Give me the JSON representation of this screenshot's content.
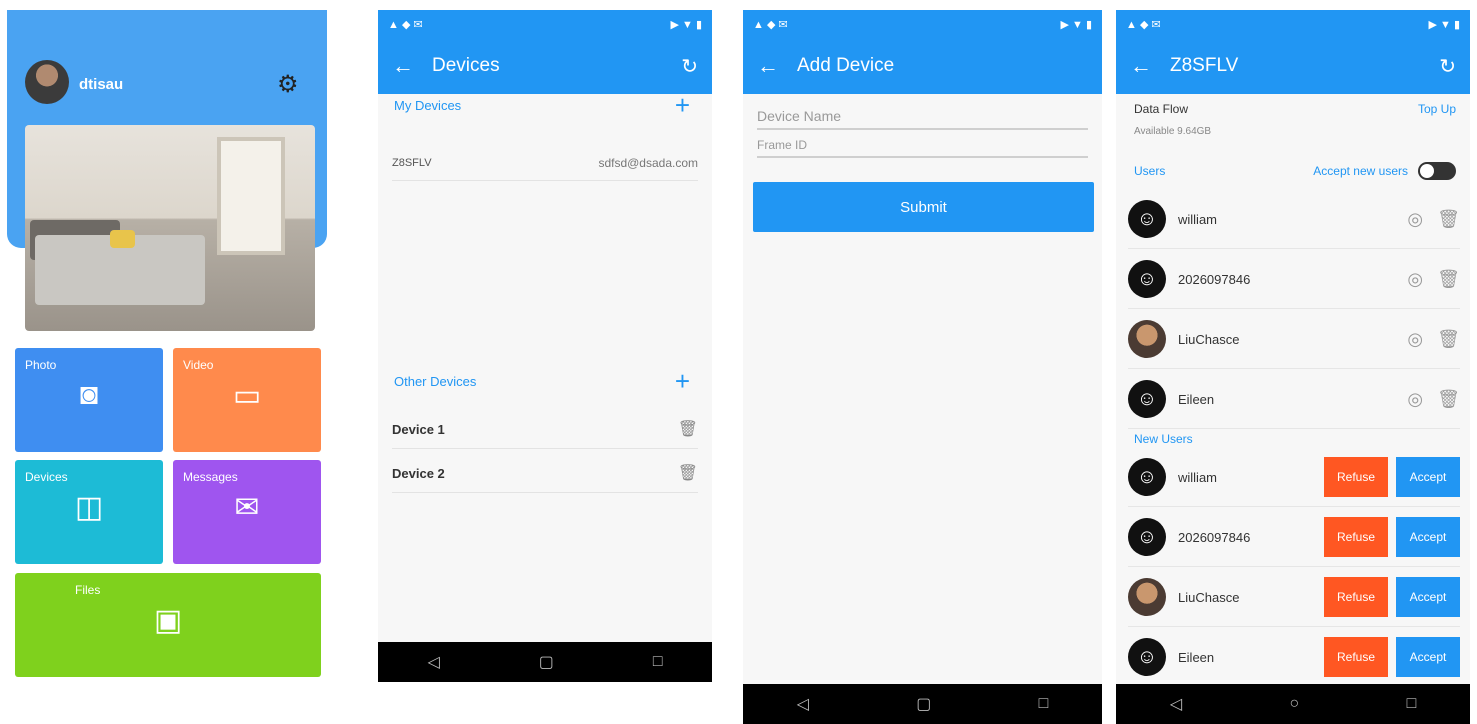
{
  "screen1": {
    "username": "dtisau",
    "tiles": [
      {
        "label": "Photo",
        "icon": "camera-icon",
        "glyph": "📷",
        "color": "#3f8ef1"
      },
      {
        "label": "Video",
        "icon": "video-icon",
        "glyph": "▭",
        "color": "#ff8a4c"
      },
      {
        "label": "Devices",
        "icon": "devices-icon",
        "glyph": "◫",
        "color": "#1dbbd6"
      },
      {
        "label": "Messages",
        "icon": "message-icon",
        "glyph": "✉",
        "color": "#9f55ef"
      },
      {
        "label": "Files",
        "icon": "image-file-icon",
        "glyph": "▣",
        "color": "#7fd11d"
      }
    ]
  },
  "screen2": {
    "title": "Devices",
    "my_devices_label": "My Devices",
    "my_devices": [
      {
        "name": "Z8SFLV",
        "detail": "sdfsd@dsada.com"
      }
    ],
    "other_devices_label": "Other Devices",
    "other_devices": [
      {
        "name": "Device 1"
      },
      {
        "name": "Device 2"
      }
    ]
  },
  "screen3": {
    "title": "Add Device",
    "device_name_placeholder": "Device Name",
    "frame_id_placeholder": "Frame ID",
    "submit_label": "Submit"
  },
  "screen4": {
    "title": "Z8SFLV",
    "storage_label": "Data Flow",
    "storage_sub": "Available 9.64GB",
    "top_up_label": "Top Up",
    "users_label": "Users",
    "accept_new_label": "Accept new users",
    "users": [
      {
        "name": "william",
        "avatar": "default"
      },
      {
        "name": "2026097846",
        "avatar": "default"
      },
      {
        "name": "LiuChasce",
        "avatar": "photo"
      },
      {
        "name": "Eileen",
        "avatar": "default"
      }
    ],
    "new_users_label": "New Users",
    "new_users": [
      {
        "name": "william",
        "avatar": "default"
      },
      {
        "name": "2026097846",
        "avatar": "default"
      },
      {
        "name": "LiuChasce",
        "avatar": "photo"
      },
      {
        "name": "Eileen",
        "avatar": "default"
      }
    ],
    "refuse_label": "Refuse",
    "accept_label": "Accept"
  }
}
